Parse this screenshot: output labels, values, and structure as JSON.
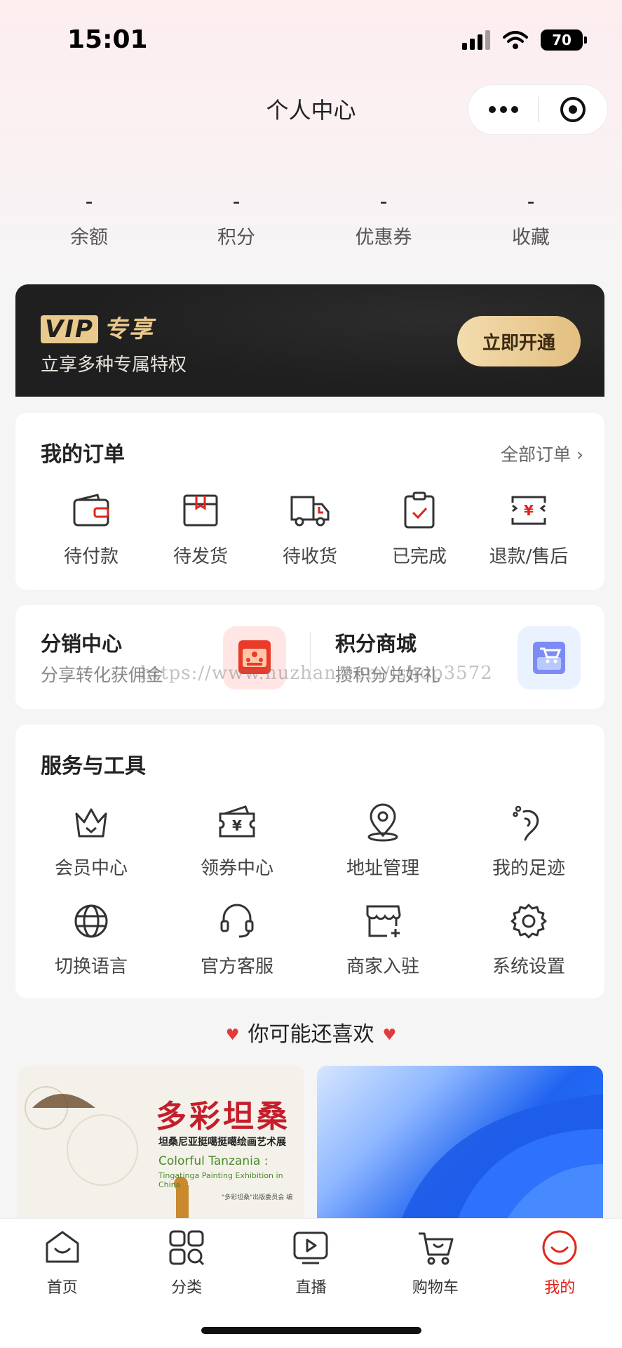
{
  "status": {
    "time": "15:01",
    "battery": "70"
  },
  "nav": {
    "title": "个人中心"
  },
  "stats": [
    {
      "value": "-",
      "label": "余额"
    },
    {
      "value": "-",
      "label": "积分"
    },
    {
      "value": "-",
      "label": "优惠券"
    },
    {
      "value": "-",
      "label": "收藏"
    }
  ],
  "vip": {
    "badge": "VIP",
    "title": "专享",
    "subtitle": "立享多种专属特权",
    "button": "立即开通"
  },
  "orders": {
    "title": "我的订单",
    "all_link": "全部订单",
    "items": [
      "待付款",
      "待发货",
      "待收货",
      "已完成",
      "退款/售后"
    ]
  },
  "promo": {
    "left": {
      "title": "分销中心",
      "subtitle": "分享转化获佣金"
    },
    "right": {
      "title": "积分商城",
      "subtitle": "攒积分兑好礼"
    }
  },
  "watermark": "https://www.huzhan.com/ishop3572",
  "tools": {
    "title": "服务与工具",
    "items": [
      "会员中心",
      "领券中心",
      "地址管理",
      "我的足迹",
      "切换语言",
      "官方客服",
      "商家入驻",
      "系统设置"
    ]
  },
  "recommend": {
    "title": "你可能还喜欢"
  },
  "products": {
    "p1": {
      "title": "多彩坦桑",
      "subtitle": "坦桑尼亚挺噶挺噶绘画艺术展",
      "en_title": "Colorful Tanzania :",
      "en_sub": "Tingatinga Painting Exhibition in China",
      "publisher": "\"多彩坦桑\"出版委员会 编"
    }
  },
  "tabbar": [
    "首页",
    "分类",
    "直播",
    "购物车",
    "我的"
  ],
  "colors": {
    "accent": "#e1251b",
    "vip_gold": "#e9c98c"
  }
}
